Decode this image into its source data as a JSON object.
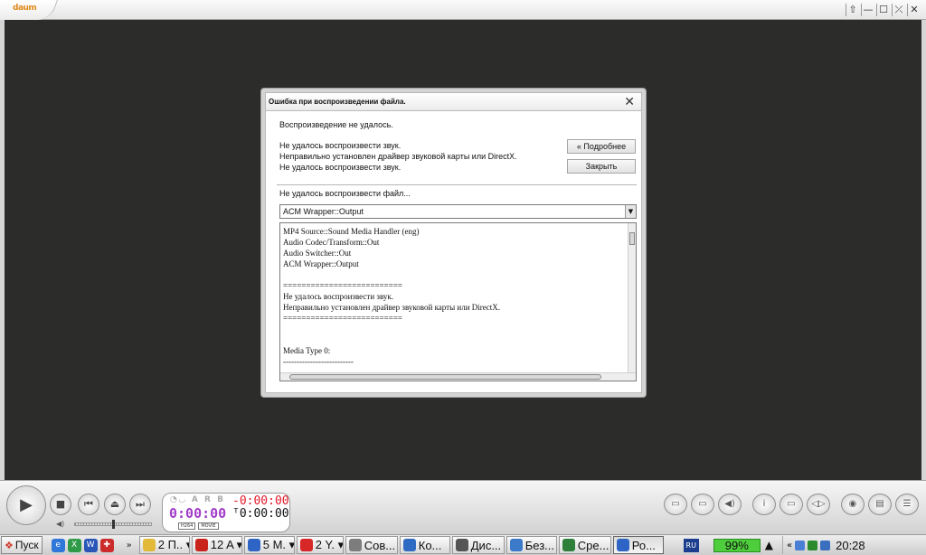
{
  "player": {
    "logo": "daum",
    "window_controls": [
      "⇧",
      "—",
      "☐",
      "⤫",
      "✕"
    ]
  },
  "dialog": {
    "title": "Ошибка при воспроизведении файла.",
    "close_glyph": "✕",
    "headline": "Воспроизведение не удалось.",
    "messages": [
      "Не удалось воспроизвести звук.",
      "Неправильно установлен драйвер звуковой карты или DirectX.",
      "Не удалось воспроизвести звук."
    ],
    "details_button": "« Подробнее",
    "close_button": "Закрыть",
    "file_error": "Не удалось воспроизвести файл...",
    "filter_select": "ACM Wrapper::Output",
    "log_lines": [
      "MP4 Source::Sound Media Handler (eng)",
      "Audio Codec/Transform::Out",
      "Audio Switcher::Out",
      "ACM Wrapper::Output",
      "",
      "==========================",
      "Не удалось воспроизвести звук.",
      "Неправильно установлен драйвер звуковой карты или DirectX.",
      "==========================",
      "",
      "",
      "Media Type 0:",
      "--------------------------"
    ]
  },
  "controls": {
    "play": "▶",
    "stop": "■",
    "prev": "⏮",
    "eject": "⏏",
    "next": "⏭",
    "volume_icon": "◀)",
    "volume_level": 0.5
  },
  "time": {
    "flags": "◔◡ A R B",
    "remaining": "-0:00:00",
    "current": "0:00:00",
    "total": "ᵀ0:00:00",
    "tags": [
      "H264",
      "MOVIE"
    ]
  },
  "right_buttons": [
    "▭",
    "▭",
    "◀)",
    "i",
    "▭",
    "◁▷",
    "◉",
    "▤",
    "☰"
  ],
  "taskbar": {
    "start_label": "Пуск",
    "quick_more": "»",
    "tasks": [
      {
        "label": "2 П.. ▾",
        "icon_color": "#e3b93a",
        "width": 56
      },
      {
        "label": "12 A ▾",
        "icon_color": "#c8241c",
        "width": 56
      },
      {
        "label": "5 M. ▾",
        "icon_color": "#2e64c4",
        "width": 56
      },
      {
        "label": "2 Y. ▾",
        "icon_color": "#d82727",
        "width": 52
      },
      {
        "label": "Сов...",
        "icon_color": "#7d7d7d",
        "width": 58
      },
      {
        "label": "Ко...",
        "icon_color": "#2f6bc2",
        "width": 56
      },
      {
        "label": "Дис...",
        "icon_color": "#555555",
        "width": 58
      },
      {
        "label": "Без...",
        "icon_color": "#3b79c9",
        "width": 56
      },
      {
        "label": "Сре...",
        "icon_color": "#2d7f3a",
        "width": 58
      },
      {
        "label": "Ро...",
        "icon_color": "#2e64c4",
        "width": 56,
        "active": true
      }
    ],
    "language": "RU",
    "battery": "99%",
    "tray_warning": "▲",
    "clock": "20:28",
    "tray_more": "«"
  },
  "colors": {
    "video_bg": "#2c2d2a",
    "time_remaining": "#e2182a",
    "time_current": "#a13cc7",
    "battery": "#4ece3c"
  }
}
